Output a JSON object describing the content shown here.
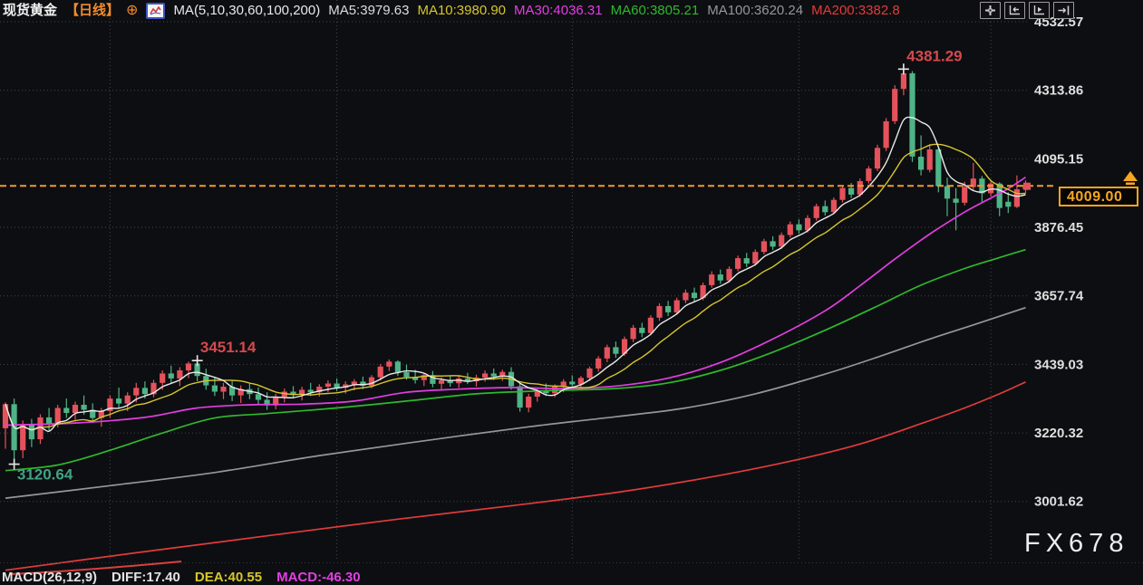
{
  "header": {
    "symbol": "现货黄金",
    "timeframe": "【日线】",
    "ma_settings": "MA(5,10,30,60,100,200)",
    "ma_items": [
      {
        "text": "MA5:3979.63",
        "color": "#dcdcdc"
      },
      {
        "text": "MA10:3980.90",
        "color": "#d6c62d"
      },
      {
        "text": "MA30:4036.31",
        "color": "#e23ee2"
      },
      {
        "text": "MA60:3805.21",
        "color": "#2eb82e"
      },
      {
        "text": "MA100:3620.24",
        "color": "#95969b"
      },
      {
        "text": "MA200:3382.8",
        "color": "#e23b3b"
      }
    ],
    "icons": [
      "circle-plus-icon",
      "line-chart-icon"
    ]
  },
  "toolbar": {
    "icons": [
      "crosshair-icon",
      "axis-compress-left-icon",
      "axis-play-icon",
      "shift-right-icon"
    ]
  },
  "price_tag": {
    "value": "4009.00",
    "color": "#f5a623"
  },
  "watermark": "FX678",
  "footer": {
    "macd_label": "MACD(26,12,9)",
    "diff": "DIFF:17.40",
    "dea": "DEA:40.55",
    "macd": "MACD:-46.30",
    "colors": {
      "macd_label": "#e3e3e3",
      "diff": "#e3e3e3",
      "dea": "#d6c62d",
      "macd": "#e23ee2"
    }
  },
  "chart_data": {
    "type": "candlestick",
    "title": "现货黄金 日线 (Spot Gold Daily)",
    "legend_position": "top",
    "grid": true,
    "y_axis": {
      "side": "right",
      "ticks": [
        4532.57,
        4313.86,
        4095.15,
        3876.45,
        3657.74,
        3439.03,
        3220.32,
        3001.62
      ],
      "tick_color": "#dfdfdf"
    },
    "x_axis": {
      "labels_visible": false,
      "month_gridline_indices": [
        12,
        38,
        65,
        91,
        113
      ]
    },
    "price_line": {
      "value": 4009.0,
      "color": "#f2992e",
      "style": "dashed"
    },
    "colors": {
      "up": "#e4525c",
      "down": "#4eb487",
      "background": "#0d0e11",
      "grid": "#46464a"
    },
    "annotations": [
      {
        "text": "4381.29",
        "color": "#d4494f",
        "index": 103,
        "price": 4381.29,
        "placement": "above"
      },
      {
        "text": "3451.14",
        "color": "#d4494f",
        "index": 22,
        "price": 3451.14,
        "placement": "above"
      },
      {
        "text": "3120.64",
        "color": "#42a183",
        "index": 1,
        "price": 3120.64,
        "placement": "below"
      }
    ],
    "ma_computed": [
      {
        "name": "MA5",
        "window": 5,
        "color": "#e9e9e9"
      },
      {
        "name": "MA10",
        "window": 10,
        "color": "#d6c62d"
      }
    ],
    "ma_lines": [
      {
        "name": "MA30",
        "color": "#e23ee2",
        "points": [
          [
            0,
            3245
          ],
          [
            8,
            3252
          ],
          [
            16,
            3270
          ],
          [
            22,
            3300
          ],
          [
            28,
            3310
          ],
          [
            34,
            3312
          ],
          [
            40,
            3322
          ],
          [
            46,
            3350
          ],
          [
            52,
            3360
          ],
          [
            58,
            3365
          ],
          [
            64,
            3362
          ],
          [
            70,
            3370
          ],
          [
            76,
            3395
          ],
          [
            82,
            3445
          ],
          [
            88,
            3520
          ],
          [
            94,
            3610
          ],
          [
            98,
            3690
          ],
          [
            102,
            3775
          ],
          [
            106,
            3855
          ],
          [
            110,
            3925
          ],
          [
            113,
            3970
          ],
          [
            115,
            4000
          ],
          [
            117,
            4036.31
          ]
        ]
      },
      {
        "name": "MA60",
        "color": "#2eb82e",
        "points": [
          [
            0,
            3100
          ],
          [
            6,
            3118
          ],
          [
            12,
            3165
          ],
          [
            18,
            3220
          ],
          [
            24,
            3268
          ],
          [
            30,
            3282
          ],
          [
            38,
            3300
          ],
          [
            46,
            3322
          ],
          [
            54,
            3345
          ],
          [
            62,
            3355
          ],
          [
            70,
            3362
          ],
          [
            76,
            3380
          ],
          [
            82,
            3420
          ],
          [
            88,
            3478
          ],
          [
            94,
            3548
          ],
          [
            100,
            3625
          ],
          [
            105,
            3692
          ],
          [
            110,
            3745
          ],
          [
            114,
            3780
          ],
          [
            117,
            3805.21
          ]
        ]
      },
      {
        "name": "MA100",
        "color": "#95969b",
        "points": [
          [
            0,
            3012
          ],
          [
            12,
            3052
          ],
          [
            24,
            3094
          ],
          [
            36,
            3148
          ],
          [
            48,
            3195
          ],
          [
            60,
            3240
          ],
          [
            70,
            3272
          ],
          [
            78,
            3300
          ],
          [
            86,
            3345
          ],
          [
            94,
            3408
          ],
          [
            100,
            3462
          ],
          [
            106,
            3520
          ],
          [
            111,
            3565
          ],
          [
            117,
            3620.24
          ]
        ]
      },
      {
        "name": "MA200",
        "color": "#e23b3b",
        "points": [
          [
            0,
            2782
          ],
          [
            15,
            2838
          ],
          [
            30,
            2892
          ],
          [
            45,
            2945
          ],
          [
            58,
            2988
          ],
          [
            70,
            3030
          ],
          [
            80,
            3075
          ],
          [
            90,
            3130
          ],
          [
            98,
            3185
          ],
          [
            105,
            3250
          ],
          [
            110,
            3300
          ],
          [
            114,
            3345
          ],
          [
            117,
            3382.8
          ]
        ]
      }
    ],
    "candles": [
      [
        3235,
        3318,
        3170,
        3312
      ],
      [
        3312,
        3330,
        3120.64,
        3165
      ],
      [
        3165,
        3260,
        3140,
        3245
      ],
      [
        3245,
        3265,
        3175,
        3200
      ],
      [
        3200,
        3280,
        3185,
        3270
      ],
      [
        3270,
        3300,
        3228,
        3248
      ],
      [
        3248,
        3310,
        3238,
        3300
      ],
      [
        3300,
        3330,
        3268,
        3284
      ],
      [
        3284,
        3320,
        3258,
        3310
      ],
      [
        3310,
        3340,
        3278,
        3294
      ],
      [
        3294,
        3315,
        3252,
        3268
      ],
      [
        3268,
        3300,
        3240,
        3290
      ],
      [
        3290,
        3340,
        3268,
        3330
      ],
      [
        3330,
        3365,
        3298,
        3314
      ],
      [
        3314,
        3350,
        3290,
        3340
      ],
      [
        3340,
        3380,
        3318,
        3364
      ],
      [
        3364,
        3385,
        3330,
        3344
      ],
      [
        3344,
        3390,
        3334,
        3380
      ],
      [
        3380,
        3420,
        3358,
        3410
      ],
      [
        3410,
        3435,
        3378,
        3394
      ],
      [
        3394,
        3430,
        3370,
        3420
      ],
      [
        3420,
        3448,
        3395,
        3442
      ],
      [
        3442,
        3451.14,
        3385,
        3402
      ],
      [
        3402,
        3425,
        3358,
        3372
      ],
      [
        3372,
        3398,
        3338,
        3352
      ],
      [
        3352,
        3380,
        3328,
        3368
      ],
      [
        3368,
        3385,
        3322,
        3340
      ],
      [
        3340,
        3372,
        3316,
        3360
      ],
      [
        3360,
        3378,
        3328,
        3344
      ],
      [
        3344,
        3366,
        3310,
        3326
      ],
      [
        3326,
        3350,
        3294,
        3308
      ],
      [
        3308,
        3345,
        3296,
        3336
      ],
      [
        3336,
        3362,
        3318,
        3352
      ],
      [
        3352,
        3370,
        3330,
        3342
      ],
      [
        3342,
        3368,
        3324,
        3358
      ],
      [
        3358,
        3380,
        3338,
        3350
      ],
      [
        3350,
        3376,
        3336,
        3368
      ],
      [
        3368,
        3388,
        3350,
        3378
      ],
      [
        3378,
        3394,
        3354,
        3365
      ],
      [
        3365,
        3385,
        3346,
        3375
      ],
      [
        3375,
        3392,
        3356,
        3384
      ],
      [
        3384,
        3400,
        3360,
        3371
      ],
      [
        3371,
        3405,
        3363,
        3398
      ],
      [
        3398,
        3440,
        3388,
        3432
      ],
      [
        3432,
        3455,
        3418,
        3448
      ],
      [
        3448,
        3452,
        3402,
        3414
      ],
      [
        3414,
        3438,
        3390,
        3399
      ],
      [
        3399,
        3422,
        3378,
        3389
      ],
      [
        3389,
        3412,
        3370,
        3405
      ],
      [
        3405,
        3418,
        3366,
        3377
      ],
      [
        3377,
        3398,
        3358,
        3388
      ],
      [
        3388,
        3404,
        3368,
        3379
      ],
      [
        3379,
        3402,
        3364,
        3394
      ],
      [
        3394,
        3412,
        3376,
        3385
      ],
      [
        3385,
        3406,
        3368,
        3397
      ],
      [
        3397,
        3420,
        3384,
        3410
      ],
      [
        3410,
        3426,
        3390,
        3401
      ],
      [
        3401,
        3422,
        3386,
        3415
      ],
      [
        3415,
        3430,
        3358,
        3369
      ],
      [
        3369,
        3385,
        3288,
        3301
      ],
      [
        3301,
        3345,
        3286,
        3336
      ],
      [
        3336,
        3365,
        3320,
        3356
      ],
      [
        3356,
        3378,
        3338,
        3347
      ],
      [
        3347,
        3375,
        3334,
        3368
      ],
      [
        3368,
        3392,
        3350,
        3384
      ],
      [
        3384,
        3404,
        3364,
        3375
      ],
      [
        3375,
        3402,
        3360,
        3396
      ],
      [
        3396,
        3432,
        3386,
        3426
      ],
      [
        3426,
        3466,
        3416,
        3458
      ],
      [
        3458,
        3502,
        3446,
        3494
      ],
      [
        3494,
        3512,
        3460,
        3473
      ],
      [
        3473,
        3528,
        3466,
        3520
      ],
      [
        3520,
        3565,
        3510,
        3556
      ],
      [
        3556,
        3572,
        3526,
        3539
      ],
      [
        3539,
        3596,
        3532,
        3588
      ],
      [
        3588,
        3634,
        3578,
        3625
      ],
      [
        3625,
        3642,
        3593,
        3605
      ],
      [
        3605,
        3652,
        3598,
        3644
      ],
      [
        3644,
        3678,
        3634,
        3668
      ],
      [
        3668,
        3684,
        3638,
        3651
      ],
      [
        3651,
        3700,
        3644,
        3692
      ],
      [
        3692,
        3736,
        3684,
        3726
      ],
      [
        3726,
        3742,
        3696,
        3707
      ],
      [
        3707,
        3752,
        3700,
        3744
      ],
      [
        3744,
        3786,
        3736,
        3778
      ],
      [
        3778,
        3795,
        3750,
        3761
      ],
      [
        3761,
        3806,
        3754,
        3798
      ],
      [
        3798,
        3840,
        3790,
        3832
      ],
      [
        3832,
        3848,
        3804,
        3815
      ],
      [
        3815,
        3860,
        3808,
        3852
      ],
      [
        3852,
        3895,
        3844,
        3886
      ],
      [
        3886,
        3902,
        3856,
        3867
      ],
      [
        3867,
        3915,
        3860,
        3906
      ],
      [
        3906,
        3952,
        3898,
        3944
      ],
      [
        3944,
        3962,
        3914,
        3925
      ],
      [
        3925,
        3972,
        3918,
        3964
      ],
      [
        3964,
        4010,
        3956,
        4002
      ],
      [
        4002,
        4018,
        3970,
        3981
      ],
      [
        3981,
        4032,
        3974,
        4024
      ],
      [
        4024,
        4072,
        4016,
        4064
      ],
      [
        4064,
        4140,
        4056,
        4130
      ],
      [
        4130,
        4225,
        4120,
        4215
      ],
      [
        4215,
        4330,
        4206,
        4318
      ],
      [
        4318,
        4381.29,
        4298,
        4368
      ],
      [
        4368,
        4375,
        4085,
        4102
      ],
      [
        4102,
        4170,
        4042,
        4060
      ],
      [
        4060,
        4142,
        4052,
        4125
      ],
      [
        4125,
        4132,
        3988,
        4008
      ],
      [
        4008,
        4035,
        3912,
        3968
      ],
      [
        3968,
        4002,
        3867,
        3955
      ],
      [
        3955,
        4022,
        3946,
        4005
      ],
      [
        4005,
        4082,
        3992,
        4032
      ],
      [
        4032,
        4040,
        3958,
        3985
      ],
      [
        3985,
        4028,
        3975,
        4016
      ],
      [
        4016,
        4020,
        3912,
        3938
      ],
      [
        3958,
        3988,
        3922,
        3942
      ],
      [
        3942,
        4042,
        3938,
        3998
      ],
      [
        3998,
        4026,
        3986,
        4009
      ]
    ],
    "macd_pane_stub": {
      "visible_fraction": "top edge only",
      "line_color": "#d94040"
    }
  }
}
